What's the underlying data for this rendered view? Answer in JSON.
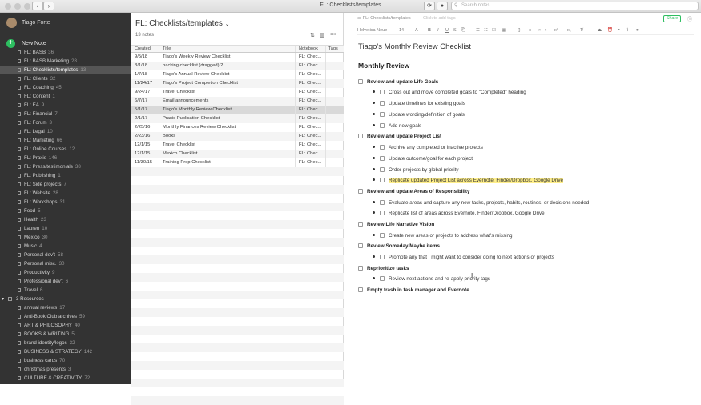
{
  "window": {
    "title": "FL: Checklists/templates",
    "search_placeholder": "Search notes"
  },
  "sidebar": {
    "user": "Tiago Forte",
    "new_note": "New Note",
    "items": [
      {
        "label": "FL: BASB",
        "count": "36"
      },
      {
        "label": "FL: BASB Marketing",
        "count": "28"
      },
      {
        "label": "FL: Checklists/templates",
        "count": "13",
        "selected": true
      },
      {
        "label": "FL: Clients",
        "count": "32"
      },
      {
        "label": "FL: Coaching",
        "count": "45"
      },
      {
        "label": "FL: Content",
        "count": "1"
      },
      {
        "label": "FL: EA",
        "count": "9"
      },
      {
        "label": "FL: Financial",
        "count": "7"
      },
      {
        "label": "FL: Forum",
        "count": "3"
      },
      {
        "label": "FL: Legal",
        "count": "10"
      },
      {
        "label": "FL: Marketing",
        "count": "66"
      },
      {
        "label": "FL: Online Courses",
        "count": "12"
      },
      {
        "label": "FL: Praxis",
        "count": "146"
      },
      {
        "label": "FL: Press/testimonials",
        "count": "38"
      },
      {
        "label": "FL: Publishing",
        "count": "1"
      },
      {
        "label": "FL: Side projects",
        "count": "7"
      },
      {
        "label": "FL: Website",
        "count": "28"
      },
      {
        "label": "FL: Workshops",
        "count": "31"
      },
      {
        "label": "Food",
        "count": "5"
      },
      {
        "label": "Health",
        "count": "23"
      },
      {
        "label": "Lauren",
        "count": "10"
      },
      {
        "label": "Mexico",
        "count": "30"
      },
      {
        "label": "Music",
        "count": "4"
      },
      {
        "label": "Personal dev't",
        "count": "58"
      },
      {
        "label": "Personal misc.",
        "count": "30"
      },
      {
        "label": "Productivity",
        "count": "9"
      },
      {
        "label": "Professional dev't",
        "count": "6"
      },
      {
        "label": "Travel",
        "count": "6"
      }
    ],
    "group": "3 Resources",
    "resources": [
      {
        "label": "annual reviews",
        "count": "17"
      },
      {
        "label": "Anti-Book Club archives",
        "count": "59"
      },
      {
        "label": "ART & PHILOSOPHY",
        "count": "40"
      },
      {
        "label": "BOOKS & WRITING",
        "count": "5"
      },
      {
        "label": "brand identity/logos",
        "count": "32"
      },
      {
        "label": "BUSINESS & STRATEGY",
        "count": "142"
      },
      {
        "label": "business cards",
        "count": "70"
      },
      {
        "label": "christmas presents",
        "count": "3"
      },
      {
        "label": "CULTURE & CREATIVITY",
        "count": "72"
      }
    ]
  },
  "notelist": {
    "title": "FL: Checklists/templates",
    "count": "13 notes",
    "columns": [
      "Created",
      "Title",
      "Notebook",
      "Tags"
    ],
    "rows": [
      [
        "9/5/18",
        "Tiago's Weekly Review Checklist",
        "FL: Chec...",
        ""
      ],
      [
        "3/1/18",
        "packing checklist (dragged) 2",
        "FL: Chec...",
        ""
      ],
      [
        "1/7/18",
        "Tiago's Annual Review Checklist",
        "FL: Chec...",
        ""
      ],
      [
        "11/24/17",
        "Tiago's Project Completion Checklist",
        "FL: Chec...",
        ""
      ],
      [
        "9/24/17",
        "Travel Checklist",
        "FL: Chec...",
        ""
      ],
      [
        "6/7/17",
        "Email announcements",
        "FL: Chec...",
        ""
      ],
      [
        "5/1/17",
        "Tiago's Monthly Review Checklist",
        "FL: Chec...",
        ""
      ],
      [
        "2/1/17",
        "Praxis Publication Checklist",
        "FL: Chec...",
        ""
      ],
      [
        "2/25/16",
        "Monthly Finances Review Checklist",
        "FL: Chec...",
        ""
      ],
      [
        "2/23/16",
        "Books",
        "FL: Chec...",
        ""
      ],
      [
        "12/1/15",
        "Travel Checklist",
        "FL: Chec...",
        ""
      ],
      [
        "12/1/15",
        "Mexico Checklist",
        "FL: Chec...",
        ""
      ],
      [
        "11/30/15",
        "Training Prep Checklist",
        "FL: Chec...",
        ""
      ]
    ]
  },
  "editor": {
    "notebook": "FL: Checklists/templates",
    "tags_placeholder": "Click to add tags",
    "share": "Share",
    "font": "Helvetica Neue",
    "size": "14",
    "title": "Tiago's Monthly Review Checklist",
    "heading": "Monthly Review",
    "items": [
      {
        "t": "Review and update Life Goals",
        "l": 1
      },
      {
        "t": "Cross out and move completed goals to \"Completed\" heading",
        "l": 2
      },
      {
        "t": "Update timelines for existing goals",
        "l": 2
      },
      {
        "t": "Update wording/definition of goals",
        "l": 2
      },
      {
        "t": "Add new goals",
        "l": 2
      },
      {
        "t": "Review and update Project List",
        "l": 1
      },
      {
        "t": "Archive any completed or inactive projects",
        "l": 2
      },
      {
        "t": "Update outcome/goal for each project",
        "l": 2
      },
      {
        "t": "Order projects by global priority",
        "l": 2
      },
      {
        "t": "Replicate updated Project List across Evernote, Finder/Dropbox, Google Drive",
        "l": 2,
        "hl": true
      },
      {
        "t": "Review and update Areas of Responsibility",
        "l": 1
      },
      {
        "t": "Evaluate areas and capture any new tasks, projects, habits, routines, or decisions needed",
        "l": 2
      },
      {
        "t": "Replicate list of areas across Evernote, Finder/Dropbox, Google Drive",
        "l": 2
      },
      {
        "t": "Review Life Narrative Vision",
        "l": 1
      },
      {
        "t": "Create new areas or projects to address what's missing",
        "l": 2
      },
      {
        "t": "Review Someday/Maybe items",
        "l": 1
      },
      {
        "t": "Promote any that I might want to consider doing to next actions or projects",
        "l": 2
      },
      {
        "t": "Reprioritize tasks",
        "l": 1
      },
      {
        "t": "Review next actions and re-apply priority tags",
        "l": 2
      },
      {
        "t": "Empty trash in task manager and Evernote",
        "l": 1
      }
    ]
  }
}
